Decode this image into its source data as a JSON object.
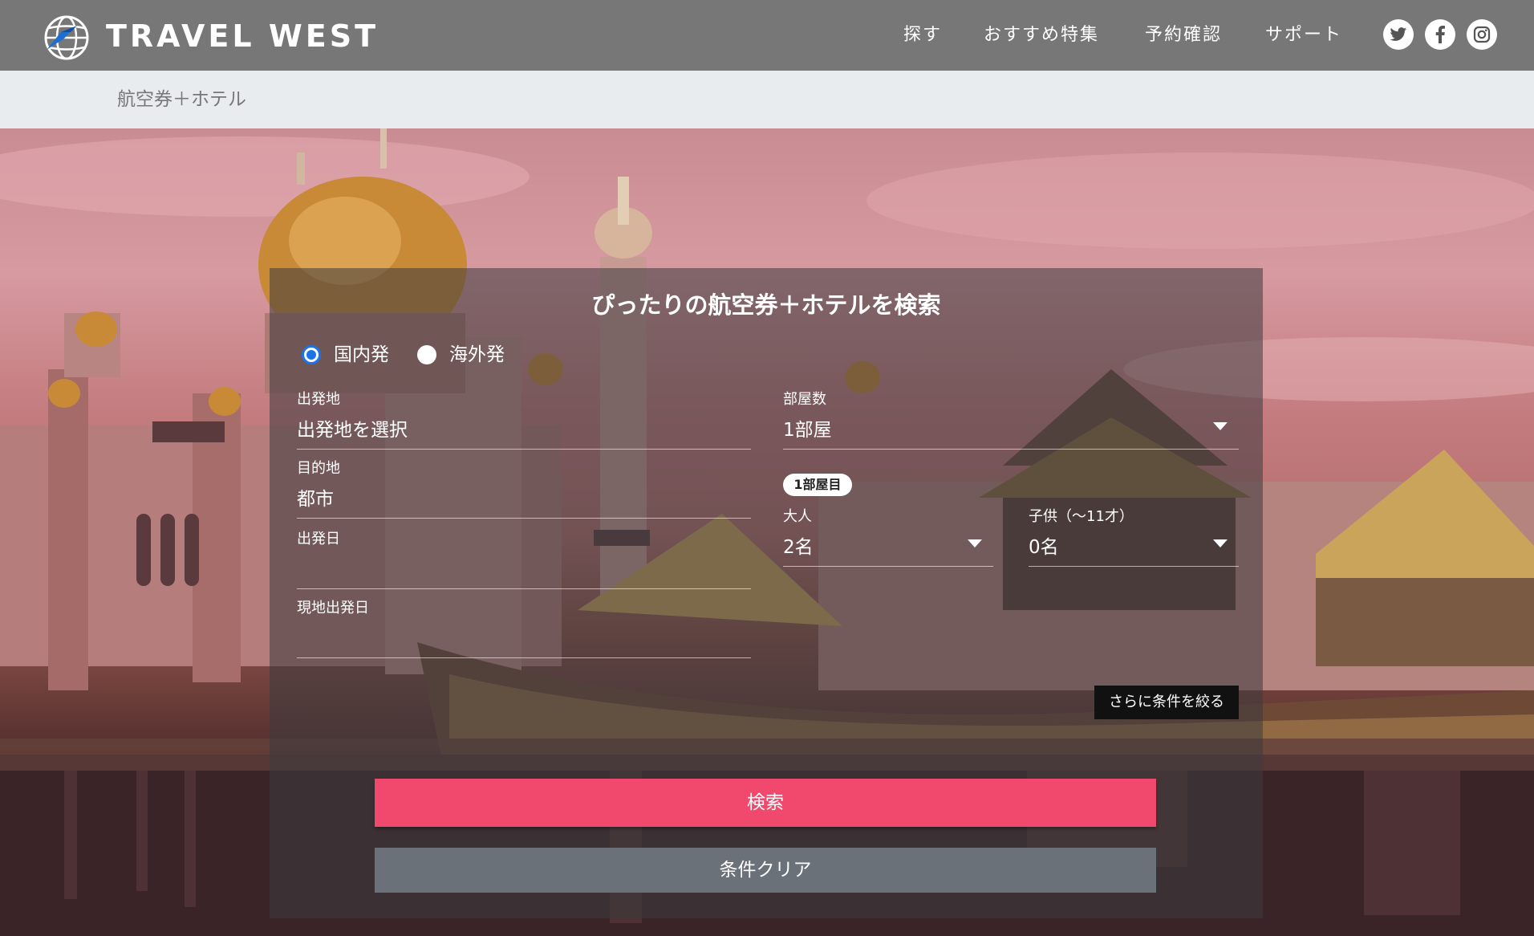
{
  "header": {
    "brand": "TRAVEL WEST",
    "nav": [
      "探す",
      "おすすめ特集",
      "予約確認",
      "サポート"
    ],
    "social_icons": [
      "twitter-icon",
      "facebook-icon",
      "instagram-icon"
    ]
  },
  "breadcrumb": {
    "current": "航空券＋ホテル"
  },
  "search": {
    "title": "ぴったりの航空券＋ホテルを検索",
    "radios": [
      {
        "label": "国内発",
        "checked": true
      },
      {
        "label": "海外発",
        "checked": false
      }
    ],
    "origin": {
      "label": "出発地",
      "value": "出発地を選択"
    },
    "destination": {
      "label": "目的地",
      "value": "都市"
    },
    "departure_date": {
      "label": "出発日",
      "value": ""
    },
    "local_departure_date": {
      "label": "現地出発日",
      "value": ""
    },
    "rooms": {
      "label": "部屋数",
      "value": "1部屋"
    },
    "room_badge": "1部屋目",
    "adults": {
      "label": "大人",
      "value": "2名"
    },
    "children": {
      "label": "子供（〜11才）",
      "value": "0名"
    },
    "more_conditions": "さらに条件を絞る",
    "search_button": "検索",
    "clear_button": "条件クリア"
  },
  "colors": {
    "header_bg": "#777777",
    "breadcrumb_bg": "#e8ecef",
    "search_button": "#f0496d",
    "clear_button": "#6b7178",
    "radio_accent": "#1a73e8"
  }
}
